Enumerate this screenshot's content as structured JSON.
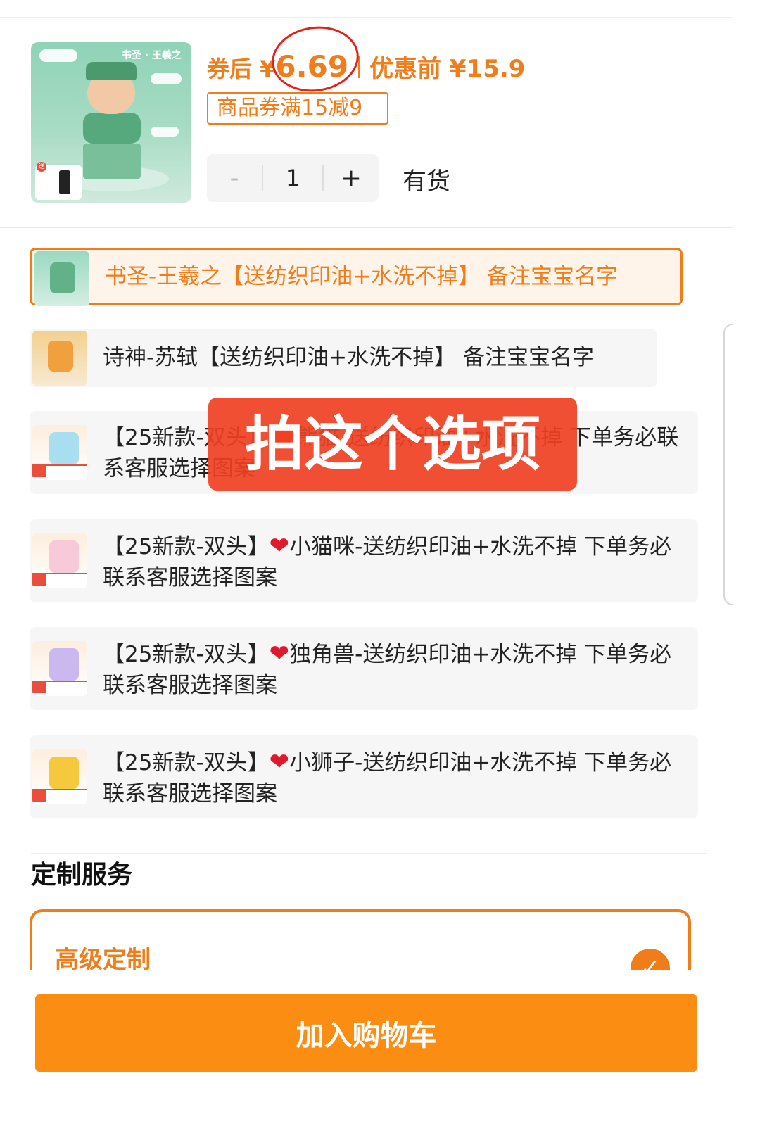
{
  "product": {
    "thumbnail_title": "书圣 · 王羲之",
    "thumbnail_gift_tag": "送",
    "price_prefix": "券后 ¥",
    "price": "6.69",
    "original_price": "优惠前 ¥15.9",
    "coupon": "商品券满15减9",
    "quantity": "1",
    "minus_label": "-",
    "plus_label": "+",
    "stock_status": "有货"
  },
  "options": [
    {
      "label": "书圣-王羲之【送纺织印油+水洗不掉】 备注宝宝名字",
      "selected": true
    },
    {
      "label": "诗神-苏轼【送纺织印油+水洗不掉】 备注宝宝名字",
      "selected": false
    },
    {
      "label": "【25新款-双头】❤️熊猫-送纺织印油+水洗不掉 下单务必联系客服选择图案",
      "selected": false
    },
    {
      "prefix": "【25新款-双头】",
      "heart": "❤",
      "label": "小猫咪-送纺织印油+水洗不掉 下单务必联系客服选择图案",
      "selected": false
    },
    {
      "prefix": "【25新款-双头】",
      "heart": "❤",
      "label": "独角兽-送纺织印油+水洗不掉 下单务必联系客服选择图案",
      "selected": false
    },
    {
      "prefix": "【25新款-双头】",
      "heart": "❤",
      "label": "小狮子-送纺织印油+水洗不掉 下单务必联系客服选择图案",
      "selected": false
    }
  ],
  "overlay_annotation": "拍这个选项",
  "custom_service": {
    "title": "定制服务",
    "option_label": "高级定制",
    "check": "✓"
  },
  "cart_button": "加入购物车",
  "colors": {
    "accent": "#f07c1a",
    "cart": "#fb8d12",
    "annotation": "#f04022"
  }
}
